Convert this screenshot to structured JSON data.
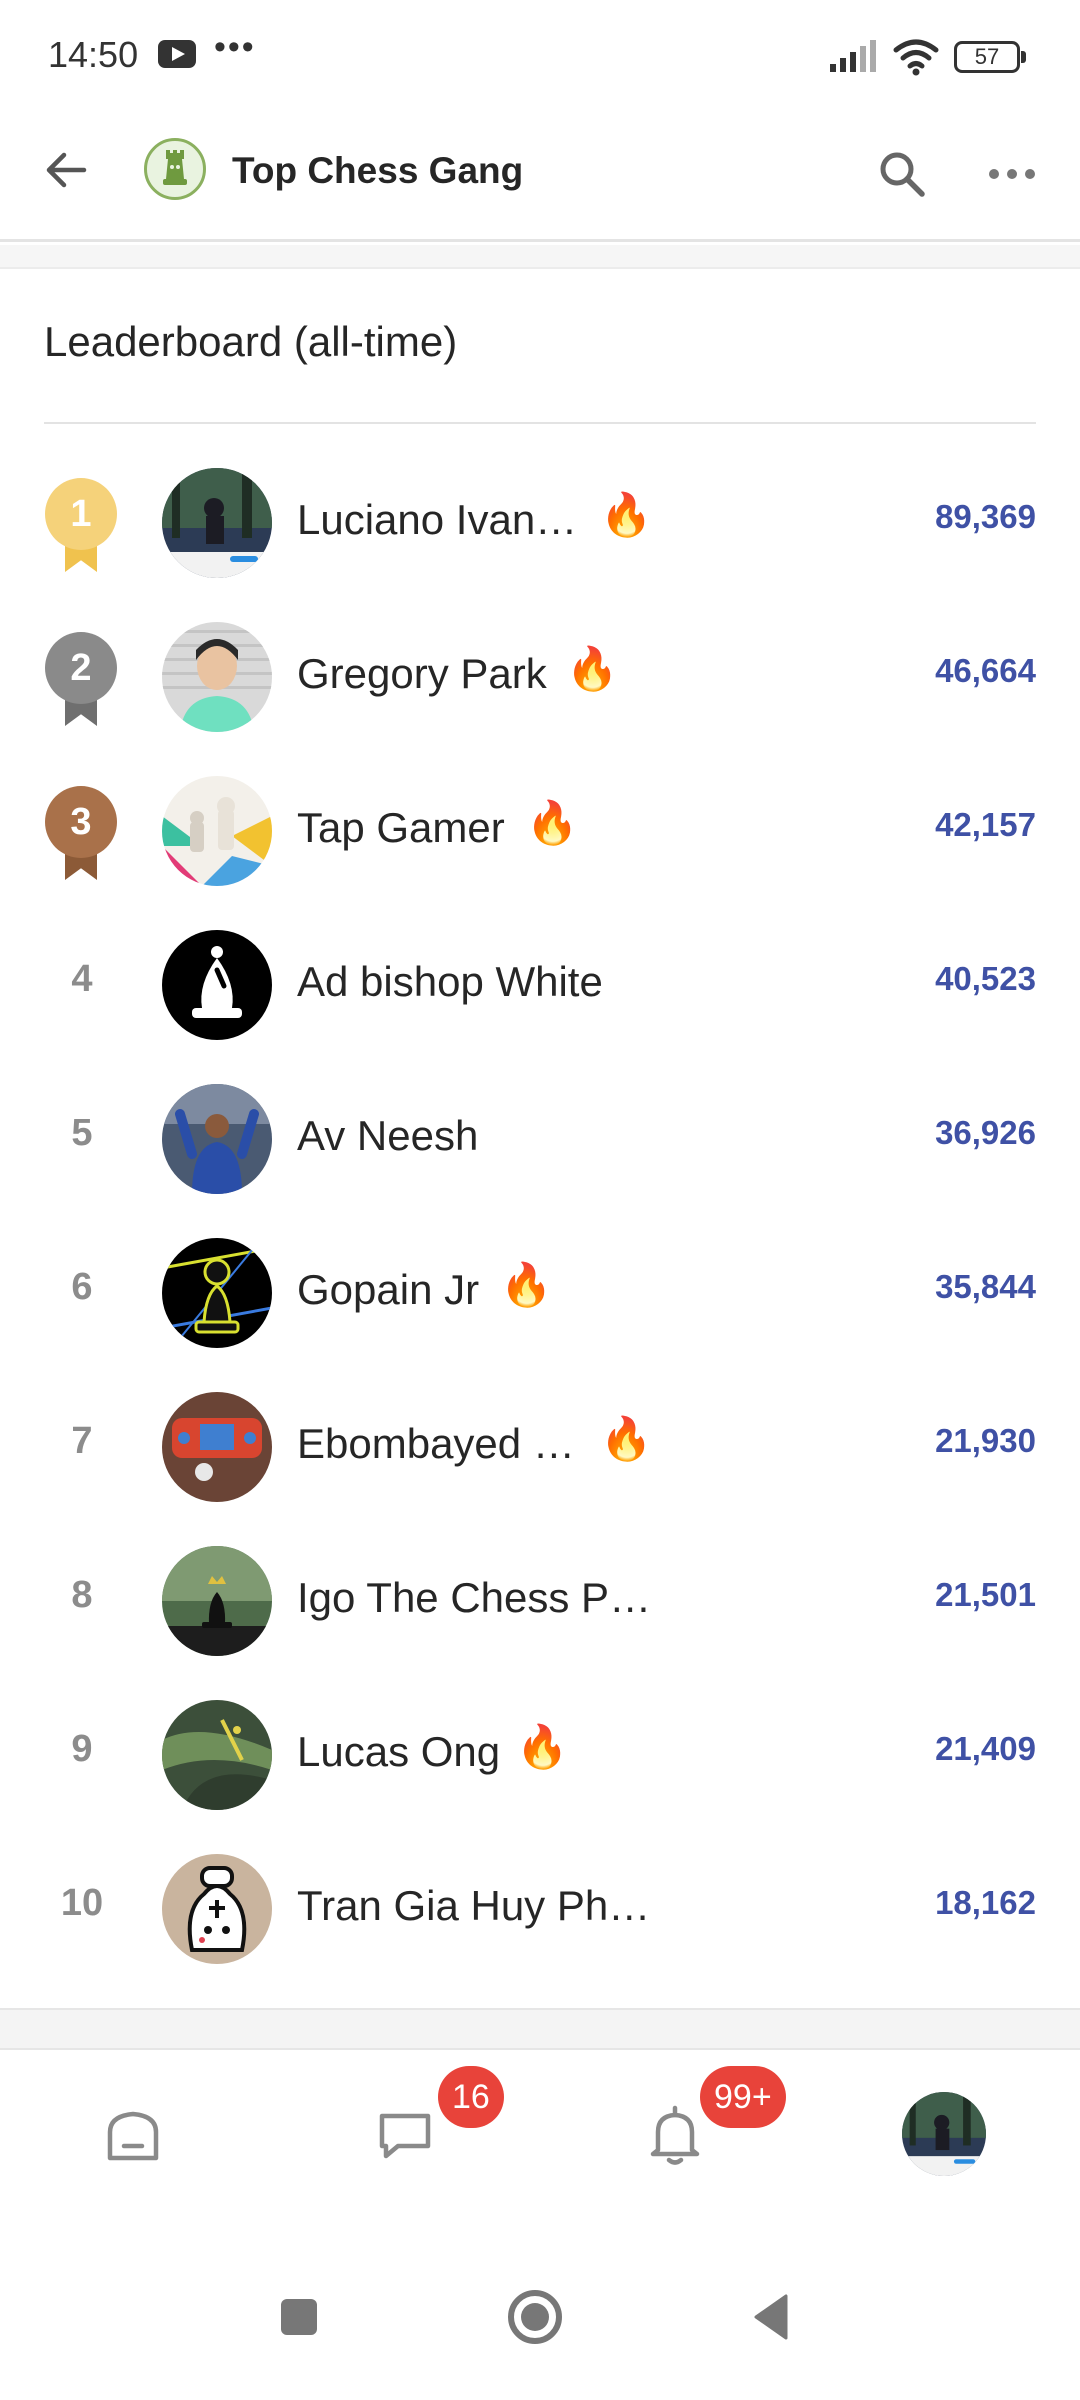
{
  "status_bar": {
    "time": "14:50",
    "more": "•••",
    "battery": "57"
  },
  "header": {
    "group_name": "Top Chess Gang"
  },
  "leaderboard": {
    "title": "Leaderboard (all-time)",
    "rows": [
      {
        "rank": "1",
        "name": "Luciano Ivan…",
        "score": "89,369",
        "fire": "🔥"
      },
      {
        "rank": "2",
        "name": "Gregory Park",
        "score": "46,664",
        "fire": "🔥"
      },
      {
        "rank": "3",
        "name": "Tap Gamer",
        "score": "42,157",
        "fire": "🔥"
      },
      {
        "rank": "4",
        "name": "Ad bishop White",
        "score": "40,523"
      },
      {
        "rank": "5",
        "name": "Av Neesh",
        "score": "36,926"
      },
      {
        "rank": "6",
        "name": "Gopain Jr",
        "score": "35,844",
        "fire": "🔥"
      },
      {
        "rank": "7",
        "name": "Ebombayed …",
        "score": "21,930",
        "fire": "🔥"
      },
      {
        "rank": "8",
        "name": "Igo The Chess P…",
        "score": "21,501"
      },
      {
        "rank": "9",
        "name": "Lucas Ong",
        "score": "21,409",
        "fire": "🔥"
      },
      {
        "rank": "10",
        "name": "Tran Gia Huy Ph…",
        "score": "18,162"
      }
    ]
  },
  "bottom_nav": {
    "messages_badge": "16",
    "notifications_badge": "99+"
  },
  "colors": {
    "score": "#3f51a5",
    "gold": "#f5d27a",
    "silver": "#8a8a8a",
    "bronze": "#a9714a",
    "badge": "#e8433a"
  },
  "icons": [
    "back-arrow-icon",
    "group-logo-icon",
    "search-icon",
    "more-icon",
    "fire-icon",
    "home-icon",
    "chat-icon",
    "bell-icon",
    "recent-apps-icon",
    "home-circle-icon",
    "back-triangle-icon"
  ]
}
